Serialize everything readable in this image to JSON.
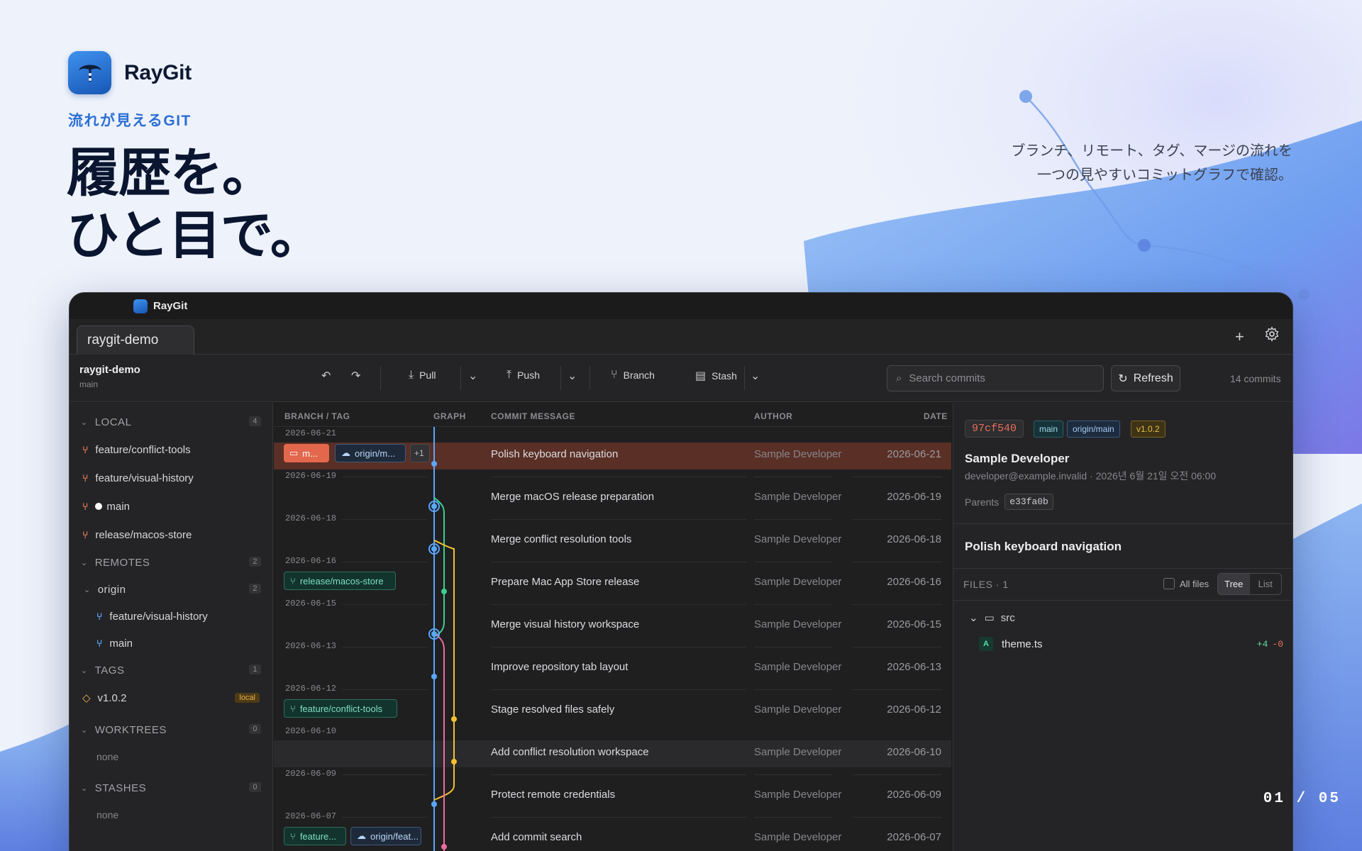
{
  "brand": {
    "app_name": "RayGit",
    "tagline": "流れが見えるGIT",
    "headline_line1": "履歴を。",
    "headline_line2": "ひと目で。",
    "subcopy_line1": "ブランチ、リモート、タグ、マージの流れを",
    "subcopy_line2": "一つの見やすいコミットグラフで確認。"
  },
  "pager": "01 / 05",
  "window": {
    "title": "RayGit",
    "tab": "raygit-demo",
    "repo": {
      "name": "raygit-demo",
      "branch": "main"
    },
    "toolbar": {
      "pull": "Pull",
      "push": "Push",
      "branch": "Branch",
      "stash": "Stash",
      "search_placeholder": "Search commits",
      "refresh": "Refresh",
      "commit_count": "14 commits"
    },
    "sidebar": {
      "local": {
        "label": "LOCAL",
        "count": "4",
        "items": [
          "feature/conflict-tools",
          "feature/visual-history",
          "main",
          "release/macos-store"
        ]
      },
      "remotes": {
        "label": "REMOTES",
        "count": "2",
        "origin": {
          "label": "origin",
          "count": "2",
          "items": [
            "feature/visual-history",
            "main"
          ]
        }
      },
      "tags": {
        "label": "TAGS",
        "count": "1",
        "items": [
          {
            "name": "v1.0.2",
            "badge": "local"
          }
        ]
      },
      "worktrees": {
        "label": "WORKTREES",
        "count": "0",
        "empty": "none"
      },
      "stashes": {
        "label": "STASHES",
        "count": "0",
        "empty": "none"
      }
    },
    "columns": {
      "branch": "BRANCH / TAG",
      "graph": "GRAPH",
      "message": "COMMIT MESSAGE",
      "author": "AUTHOR",
      "date": "DATE"
    },
    "commits": [
      {
        "group": "2026-06-21",
        "message": "Polish keyboard navigation",
        "author": "Sample Developer",
        "date": "2026-06-21",
        "refs": [
          "m...",
          "origin/m...",
          "+1"
        ]
      },
      {
        "group": "2026-06-19",
        "message": "Merge macOS release preparation",
        "author": "Sample Developer",
        "date": "2026-06-19"
      },
      {
        "group": "2026-06-18",
        "message": "Merge conflict resolution tools",
        "author": "Sample Developer",
        "date": "2026-06-18"
      },
      {
        "group": "2026-06-16",
        "message": "Prepare Mac App Store release",
        "author": "Sample Developer",
        "date": "2026-06-16",
        "refs": [
          "release/macos-store"
        ]
      },
      {
        "group": "2026-06-15",
        "message": "Merge visual history workspace",
        "author": "Sample Developer",
        "date": "2026-06-15"
      },
      {
        "group": "2026-06-13",
        "message": "Improve repository tab layout",
        "author": "Sample Developer",
        "date": "2026-06-13"
      },
      {
        "group": "2026-06-12",
        "message": "Stage resolved files safely",
        "author": "Sample Developer",
        "date": "2026-06-12",
        "refs": [
          "feature/conflict-tools"
        ]
      },
      {
        "group": "2026-06-10",
        "message": "Add conflict resolution workspace",
        "author": "Sample Developer",
        "date": "2026-06-10"
      },
      {
        "group": "2026-06-09",
        "message": "Protect remote credentials",
        "author": "Sample Developer",
        "date": "2026-06-09"
      },
      {
        "group": "2026-06-07",
        "message": "Add commit search",
        "author": "Sample Developer",
        "date": "2026-06-07",
        "refs": [
          "feature...",
          "origin/feat..."
        ]
      }
    ],
    "detail": {
      "hash": "97cf540",
      "refs": [
        "main",
        "origin/main",
        "v1.0.2"
      ],
      "author": "Sample Developer",
      "meta": "developer@example.invalid · 2026년 6월 21일 오전 06:00",
      "parents_label": "Parents",
      "parent": "e33fa0b",
      "subject": "Polish keyboard navigation",
      "files_label": "FILES · 1",
      "all_files": "All files",
      "view_tree": "Tree",
      "view_list": "List",
      "dir": "src",
      "file": {
        "status": "A",
        "name": "theme.ts",
        "added": "+4",
        "deleted": "-0"
      }
    }
  },
  "colors": {
    "accent": "#2c6fd6",
    "selected_row": "#5a2f25",
    "lane_main": "#5aa7ff",
    "lane_green": "#3ccf8f",
    "lane_yellow": "#f2c230",
    "lane_pink": "#ef6aa0"
  }
}
